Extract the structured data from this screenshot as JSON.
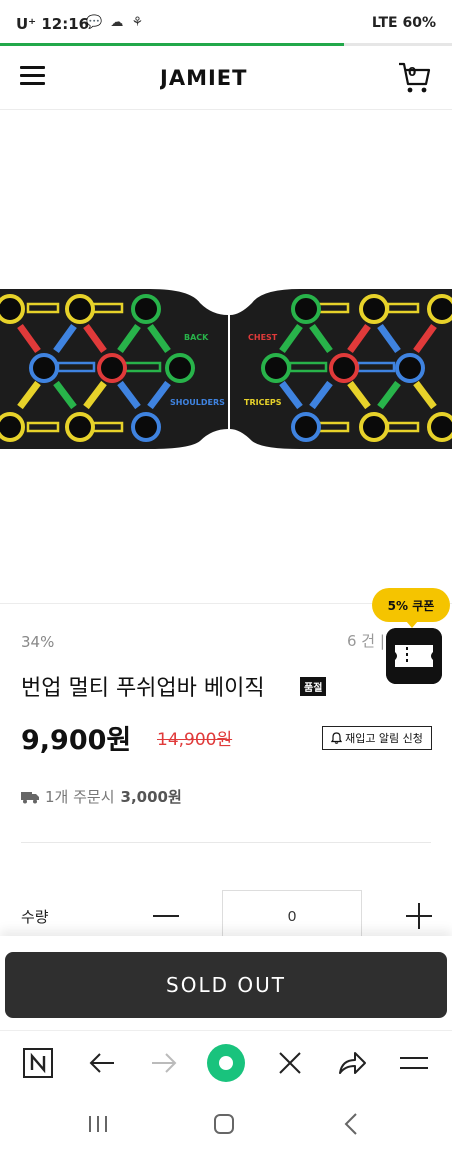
{
  "status": {
    "time": "U⁺ 12:16",
    "right": "LTE 60%"
  },
  "header": {
    "logo": "JAMIET",
    "cart_count": "0"
  },
  "image": {
    "labels": [
      "BACK",
      "SHOULDERS",
      "CHEST",
      "TRICEPS"
    ]
  },
  "coupon": {
    "label": "5% 쿠폰"
  },
  "product": {
    "discount": "34%",
    "reviews": "6 건 |",
    "title": "번업 멀티 푸쉬업바 베이직",
    "badge": "품절",
    "price": "9,900원",
    "original_price": "14,900원",
    "restock_label": "재입고 알림 신청",
    "shipping_prefix": "1개 주문시",
    "shipping_fee": "3,000원"
  },
  "quantity": {
    "label": "수량",
    "value": "0"
  },
  "soldout_label": "SOLD OUT",
  "colors": {
    "accent_green": "#22a84a",
    "coupon_yellow": "#f5c400",
    "price_red": "#e03a3a",
    "soldout_bg": "#2f2f2f",
    "browser_green": "#19c37d"
  }
}
